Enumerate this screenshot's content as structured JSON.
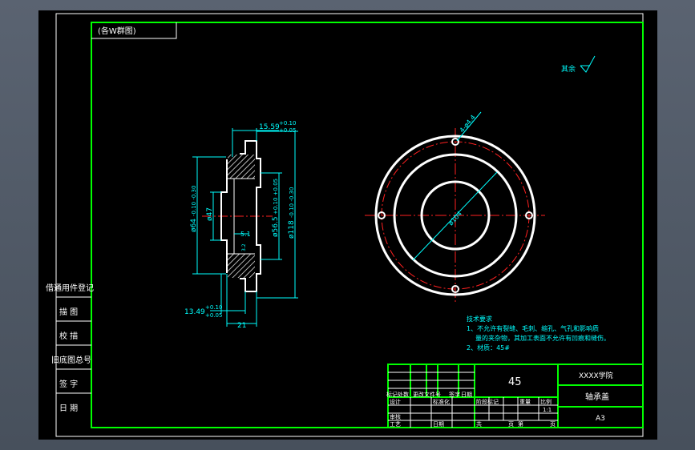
{
  "colors": {
    "frame": "#00ff00",
    "outline": "#ffffff",
    "dimension": "#00ffff",
    "centerline": "#ff2020",
    "background": "#000000",
    "workspace": "#4d5663"
  },
  "corner_label": "(各W群图)",
  "surface_note": "其余",
  "section_view": {
    "dims": {
      "top_width": "15.59",
      "top_tol_upper": "+0.10",
      "top_tol_lower": "+0.05",
      "left_outer": "ø64",
      "left_outer_tol": "-0.10 -0.30",
      "left_inner": "ø47",
      "inner_center": "ø56.5",
      "inner_center_tol": "+0.10 +0.05",
      "right_outer": "ø118",
      "right_outer_tol": "-0.10 -0.30",
      "step": "5.1",
      "bottom_width": "13.49",
      "bottom_tol_upper": "+0.10",
      "bottom_tol_lower": "+0.05",
      "total_width": "21",
      "roughness": "3.2"
    }
  },
  "front_view": {
    "holes_label": "4-ø4.4",
    "diameter_label": "ø104"
  },
  "tech_requirements": {
    "title": "技术要求",
    "item1": "1、不允许有裂缝、毛刺、缩孔、气孔和影响质",
    "item1_cont": "量的夹杂物，其加工表面不允许有凹痕和缝伤。",
    "item2": "2、材质：45#"
  },
  "left_column": {
    "row1": "借通用件登记",
    "row2": "描  图",
    "row3": "校  描",
    "row4": "旧底图总号",
    "row5": "签  字",
    "row6": "日  期"
  },
  "title_block": {
    "material": "45",
    "school": "XXXX学院",
    "part_name": "轴承盖",
    "sheet_size": "A3",
    "scale": "1:1",
    "header_marks": "标记处数",
    "header_file": "更改文件号",
    "header_sign": "签字",
    "header_date": "日期",
    "design": "设计",
    "standardize": "标准化",
    "stage_mark": "阶段标记",
    "weight": "重量",
    "scale_label": "比例",
    "audit": "审核",
    "process": "工艺",
    "date": "日期",
    "total": "共",
    "sheets": "页",
    "page": "第",
    "page_suffix": "页"
  }
}
